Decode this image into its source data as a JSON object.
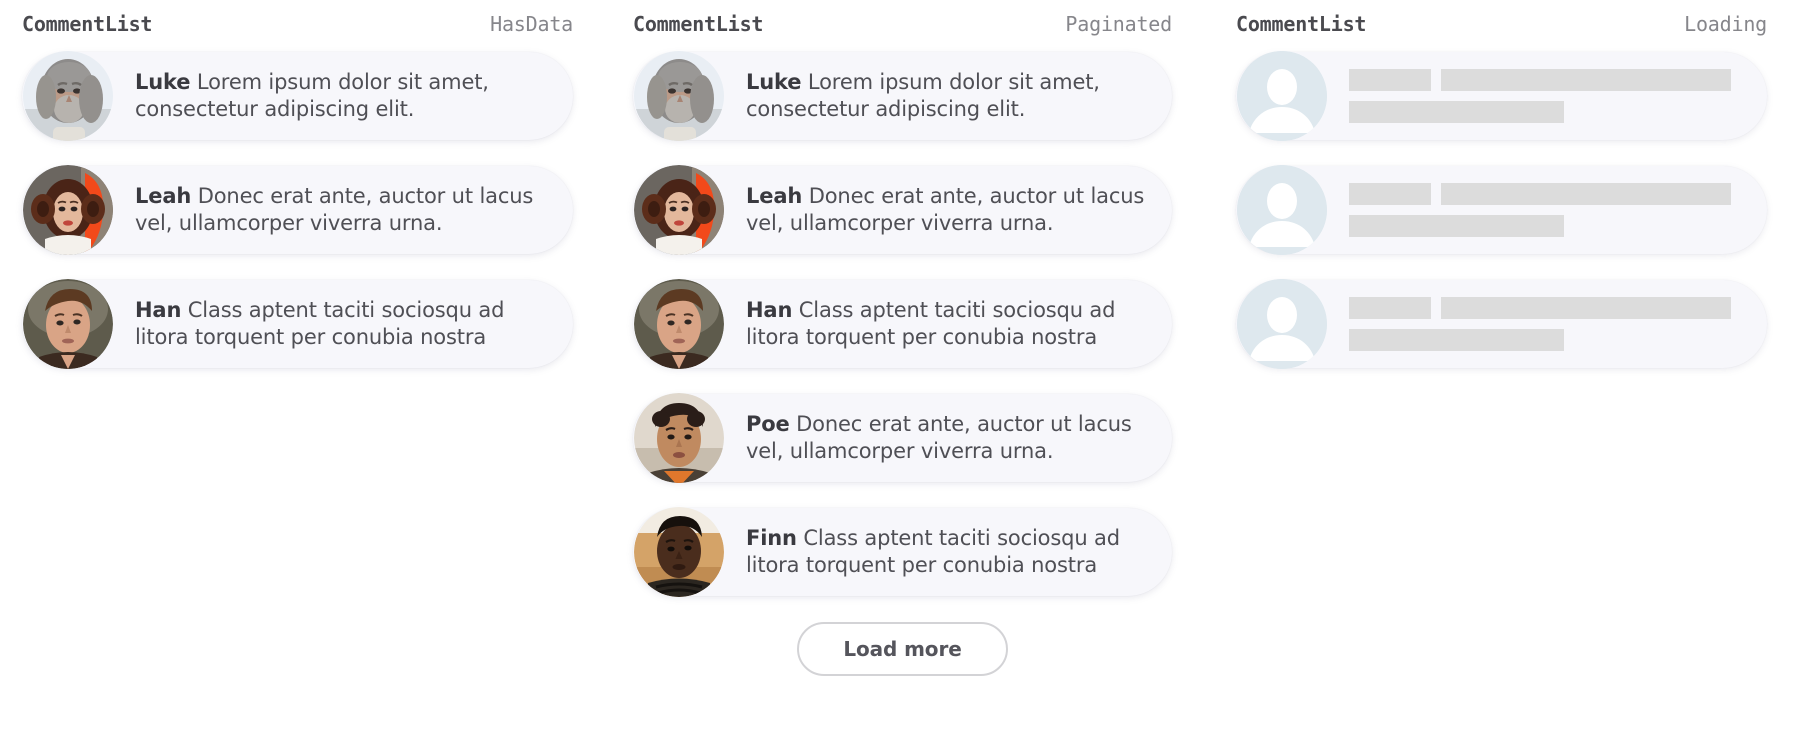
{
  "columns": [
    {
      "title": "CommentList",
      "state": "HasData",
      "variant": "has-data",
      "comments": [
        {
          "author": "Luke",
          "text": "Lorem ipsum dolor sit amet, consectetur adipiscing elit.",
          "avatar": "luke-avatar"
        },
        {
          "author": "Leah",
          "text": "Donec erat ante, auctor ut lacus vel, ullamcorper viverra urna.",
          "avatar": "leah-avatar"
        },
        {
          "author": "Han",
          "text": "Class aptent taciti sociosqu ad litora torquent per conubia nostra",
          "avatar": "han-avatar"
        }
      ]
    },
    {
      "title": "CommentList",
      "state": "Paginated",
      "variant": "paginated",
      "comments": [
        {
          "author": "Luke",
          "text": "Lorem ipsum dolor sit amet, consectetur adipiscing elit.",
          "avatar": "luke-avatar"
        },
        {
          "author": "Leah",
          "text": "Donec erat ante, auctor ut lacus vel, ullamcorper viverra urna.",
          "avatar": "leah-avatar"
        },
        {
          "author": "Han",
          "text": "Class aptent taciti sociosqu ad litora torquent per conubia nostra",
          "avatar": "han-avatar"
        },
        {
          "author": "Poe",
          "text": "Donec erat ante, auctor ut lacus vel, ullamcorper viverra urna.",
          "avatar": "poe-avatar"
        },
        {
          "author": "Finn",
          "text": "Class aptent taciti sociosqu ad litora torquent per conubia nostra",
          "avatar": "finn-avatar"
        }
      ],
      "load_more_label": "Load more"
    },
    {
      "title": "CommentList",
      "state": "Loading",
      "variant": "loading",
      "skeleton_count": 3,
      "skeleton_avatar_icon": "person-placeholder-icon"
    }
  ],
  "colors": {
    "card_background": "#f7f7fb",
    "page_background": "#ffffff",
    "title_text": "#4a4a4f",
    "state_text": "#86868b",
    "body_text": "#4f4f55",
    "author_text": "#3a3a40",
    "skeleton_bar": "#dcdcdc",
    "skeleton_avatar": "#dee8ee",
    "button_border": "#d3d3d6"
  }
}
